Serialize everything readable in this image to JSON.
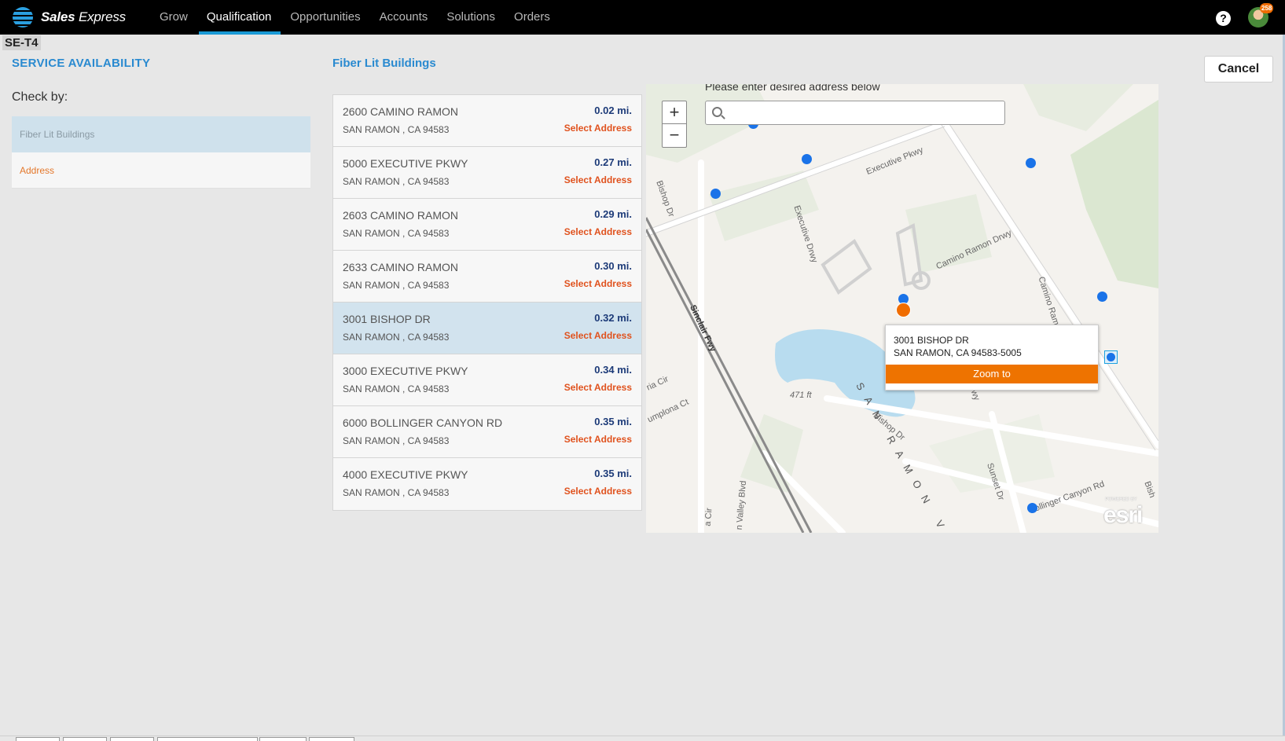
{
  "app": {
    "brand_bold": "Sales",
    "brand_light": " Express"
  },
  "nav": {
    "items": [
      {
        "label": "Grow"
      },
      {
        "label": "Qualification"
      },
      {
        "label": "Opportunities"
      },
      {
        "label": "Accounts"
      },
      {
        "label": "Solutions"
      },
      {
        "label": "Orders"
      }
    ],
    "active": "Qualification"
  },
  "header": {
    "help_glyph": "?",
    "notification_count": "258",
    "env_tag": "SE-T4"
  },
  "left": {
    "title": "SERVICE AVAILABILITY",
    "check_label": "Check by:",
    "options": [
      {
        "label": "Fiber Lit Buildings",
        "selected": true
      },
      {
        "label": "Address",
        "selected": false
      }
    ]
  },
  "middle": {
    "title": "Fiber Lit Buildings",
    "select_label": "Select Address",
    "buildings": [
      {
        "street": "2600 CAMINO RAMON",
        "city": "SAN RAMON , CA 94583",
        "distance": "0.02 mi.",
        "selected": false
      },
      {
        "street": "5000 EXECUTIVE PKWY",
        "city": "SAN RAMON , CA 94583",
        "distance": "0.27 mi.",
        "selected": false
      },
      {
        "street": "2603 CAMINO RAMON",
        "city": "SAN RAMON , CA 94583",
        "distance": "0.29 mi.",
        "selected": false
      },
      {
        "street": "2633 CAMINO RAMON",
        "city": "SAN RAMON , CA 94583",
        "distance": "0.30 mi.",
        "selected": false
      },
      {
        "street": "3001 BISHOP DR",
        "city": "SAN RAMON , CA 94583",
        "distance": "0.32 mi.",
        "selected": true
      },
      {
        "street": "3000 EXECUTIVE PKWY",
        "city": "SAN RAMON , CA 94583",
        "distance": "0.34 mi.",
        "selected": false
      },
      {
        "street": "6000 BOLLINGER CANYON RD",
        "city": "SAN RAMON , CA 94583",
        "distance": "0.35 mi.",
        "selected": false
      },
      {
        "street": "4000 EXECUTIVE PKWY",
        "city": "SAN RAMON , CA 94583",
        "distance": "0.35 mi.",
        "selected": false
      }
    ]
  },
  "map": {
    "prompt": "Please enter desired address below",
    "search_placeholder": "",
    "zoom_in": "+",
    "zoom_out": "−",
    "labels": {
      "executive_pkwy": "Executive Pkwy",
      "bishop_dr": "Bishop Dr",
      "executive_drwy": "Executive Drwy",
      "camino_ramon_drwy": "Camino Ramon Drwy",
      "camino_ramon": "Camino Ram",
      "sinclair_fwy": "Sinclair Fwy",
      "elevation": "471 ft",
      "bishop_dr_2": "Bishop Dr",
      "san_ramon_v": "SAN RAMON V",
      "sunset_dr": "Sunset Dr",
      "bollinger": "Bollinger Canyon Rd",
      "valley_blvd": "n Valley Blvd",
      "umplona": "umplona Ct",
      "ria_cir": "ria Cir",
      "a_cir": "a Cir",
      "bish": "Bish",
      "wy": "wy"
    },
    "popup": {
      "line1": "3001 BISHOP DR",
      "line2": "SAN RAMON, CA 94583-5005",
      "button": "Zoom to"
    },
    "attribution": "esri",
    "attribution_small": "POWERED BY",
    "colors": {
      "marker": "#1a73e8",
      "selected_marker": "#f06d00",
      "water": "#b8dcef",
      "park": "#dfe8d6"
    }
  },
  "actions": {
    "cancel": "Cancel"
  }
}
